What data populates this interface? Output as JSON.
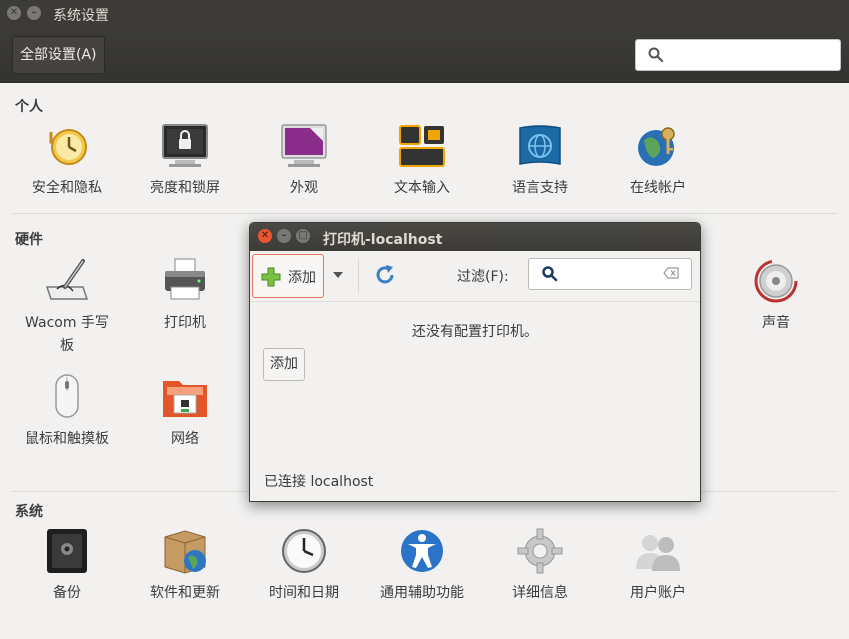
{
  "window": {
    "title": "系统设置"
  },
  "toolbar": {
    "all_settings_label": "全部设置(A)",
    "search_placeholder": ""
  },
  "sections": {
    "personal": {
      "title": "个人",
      "items": [
        {
          "label": "安全和隐私",
          "icon": "clock-history-icon"
        },
        {
          "label": "亮度和锁屏",
          "icon": "monitor-lock-icon"
        },
        {
          "label": "外观",
          "icon": "appearance-monitor-icon"
        },
        {
          "label": "文本输入",
          "icon": "keyboard-icon"
        },
        {
          "label": "语言支持",
          "icon": "language-flag-icon"
        },
        {
          "label": "在线帐户",
          "icon": "globe-key-icon"
        }
      ]
    },
    "hardware": {
      "title": "硬件",
      "items": [
        {
          "label": "Wacom 手写",
          "label2": "板",
          "icon": "tablet-pen-icon"
        },
        {
          "label": "打印机",
          "icon": "printer-icon"
        },
        {
          "label": "声音",
          "icon": "speaker-icon"
        },
        {
          "label": "鼠标和触摸板",
          "icon": "mouse-icon"
        },
        {
          "label": "网络",
          "icon": "network-folder-icon"
        }
      ]
    },
    "system": {
      "title": "系统",
      "items": [
        {
          "label": "备份",
          "icon": "safe-icon"
        },
        {
          "label": "软件和更新",
          "icon": "package-globe-icon"
        },
        {
          "label": "时间和日期",
          "icon": "clock-icon"
        },
        {
          "label": "通用辅助功能",
          "icon": "accessibility-icon"
        },
        {
          "label": "详细信息",
          "icon": "gear-icon"
        },
        {
          "label": "用户账户",
          "icon": "users-icon"
        }
      ]
    }
  },
  "dialog": {
    "title": "打印机-localhost",
    "add_label": "添加",
    "filter_label": "过滤(F):",
    "filter_placeholder": "",
    "empty_message": "还没有配置打印机。",
    "add_button_label": "添加",
    "status": "已连接 localhost"
  },
  "colors": {
    "titlebar": "#3c3b37",
    "close_button": "#e9552f",
    "background": "#f2f1f0",
    "add_button_border": "#e07a5f"
  }
}
